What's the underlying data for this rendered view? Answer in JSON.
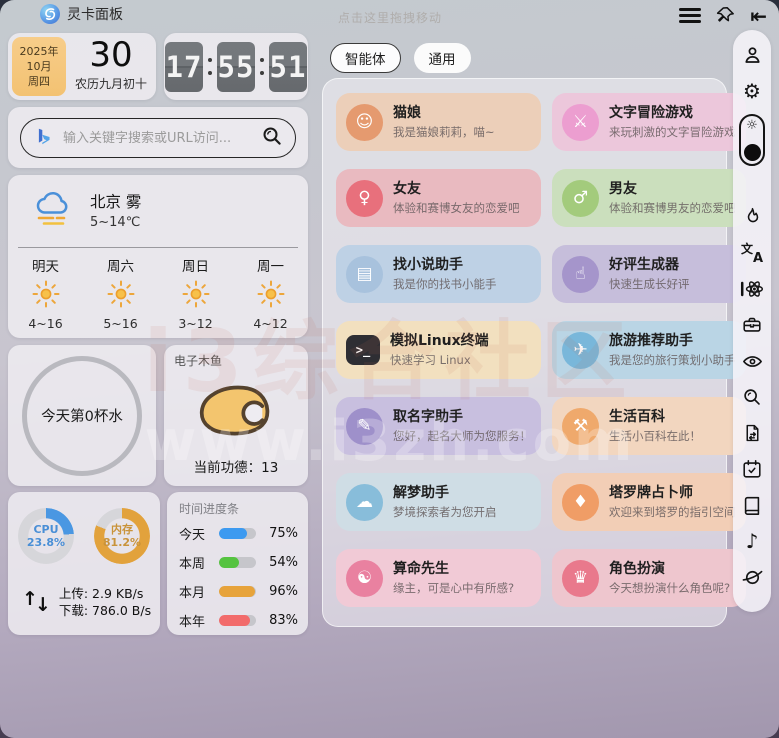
{
  "window": {
    "title": "灵卡面板",
    "drag_hint": "点击这里拖拽移动"
  },
  "titlebar": {
    "icons": [
      "menu-icon",
      "pin-icon",
      "collapse-icon"
    ],
    "collapse_glyph": "⇤"
  },
  "date_card": {
    "year": "2025年",
    "month": "10月",
    "weekday": "周四",
    "day": "30",
    "lunar": "农历九月初十"
  },
  "clock": {
    "hours": "17",
    "minutes": "55",
    "seconds": "51"
  },
  "search": {
    "placeholder": "输入关键字搜索或URL访问...",
    "engine_icon": "bing-logo-icon"
  },
  "weather": {
    "city_condition": "北京 雾",
    "temp_range": "5~14℃",
    "forecast": [
      {
        "day": "明天",
        "temps": "4~16"
      },
      {
        "day": "周六",
        "temps": "5~16"
      },
      {
        "day": "周日",
        "temps": "3~12"
      },
      {
        "day": "周一",
        "temps": "4~12"
      }
    ]
  },
  "water": {
    "label": "今天第0杯水"
  },
  "muyu": {
    "title": "电子木鱼",
    "merit": "当前功德：13"
  },
  "system": {
    "cpu_label": "CPU",
    "cpu_value": "23.8%",
    "cpu_pct": 23.8,
    "cpu_color": "#4a97e2",
    "mem_label": "内存",
    "mem_value": "81.2%",
    "mem_pct": 81.2,
    "mem_color": "#e2a23c",
    "upload": "上传: 2.9 KB/s",
    "download": "下载: 786.0 B/s"
  },
  "time_progress": {
    "title": "时间进度条",
    "rows": [
      {
        "label": "今天",
        "value": "75%",
        "pct": 75,
        "color": "#3d9af0"
      },
      {
        "label": "本周",
        "value": "54%",
        "pct": 54,
        "color": "#55c340"
      },
      {
        "label": "本月",
        "value": "96%",
        "pct": 96,
        "color": "#e7a33b"
      },
      {
        "label": "本年",
        "value": "83%",
        "pct": 83,
        "color": "#f26b6b"
      }
    ]
  },
  "tabs": [
    {
      "label": "智能体",
      "active": true
    },
    {
      "label": "通用",
      "active": false
    }
  ],
  "agents": {
    "cards": [
      {
        "title": "猫娘",
        "subtitle": "我是猫娘莉莉，喵~",
        "icon": "cat-girl-avatar",
        "glyph": "☺",
        "card_color": "#eccfb9",
        "avatar_color": "#e59a6f"
      },
      {
        "title": "文字冒险游戏",
        "subtitle": "来玩刺激的文字冒险游戏",
        "icon": "pixel-adventurer-avatar",
        "glyph": "⚔",
        "card_color": "#ecc7db",
        "avatar_color": "#ec9ed0"
      },
      {
        "title": "女友",
        "subtitle": "体验和赛博女友的恋爱吧",
        "icon": "girlfriend-avatar",
        "glyph": "♀",
        "card_color": "#e9bac0",
        "avatar_color": "#e8707c"
      },
      {
        "title": "男友",
        "subtitle": "体验和赛博男友的恋爱吧",
        "icon": "boyfriend-avatar",
        "glyph": "♂",
        "card_color": "#cbdfbd",
        "avatar_color": "#a3cb7c"
      },
      {
        "title": "找小说助手",
        "subtitle": "我是你的找书小能手",
        "icon": "book-search-avatar",
        "glyph": "▤",
        "card_color": "#bed1e5",
        "avatar_color": "#a8c2dd"
      },
      {
        "title": "好评生成器",
        "subtitle": "快速生成长好评",
        "icon": "thumbs-up-avatar",
        "glyph": "☝",
        "card_color": "#c6bedb",
        "avatar_color": "#a595cb"
      },
      {
        "title": "模拟Linux终端",
        "subtitle": "快速学习 Linux",
        "icon": "linux-terminal-avatar",
        "glyph": ">_",
        "card_color": "#f2e0bf",
        "avatar_color": "#2e2e33",
        "square": true
      },
      {
        "title": "旅游推荐助手",
        "subtitle": "我是您的旅行策划小助手",
        "icon": "travel-landscape-avatar",
        "glyph": "✈",
        "card_color": "#bad5e5",
        "avatar_color": "#79b7da"
      },
      {
        "title": "取名字助手",
        "subtitle": "您好，起名大师为您服务！",
        "icon": "baby-naming-avatar",
        "glyph": "✎",
        "card_color": "#c8bfdf",
        "avatar_color": "#9e90ca"
      },
      {
        "title": "生活百科",
        "subtitle": "生活小百科在此！",
        "icon": "life-tips-avatar",
        "glyph": "⚒",
        "card_color": "#f2d6bf",
        "avatar_color": "#efa96c"
      },
      {
        "title": "解梦助手",
        "subtitle": "梦境探索者为您开启",
        "icon": "dream-avatar",
        "glyph": "☁",
        "card_color": "#cfdde5",
        "avatar_color": "#88bdda"
      },
      {
        "title": "塔罗牌占卜师",
        "subtitle": "欢迎来到塔罗的指引空间",
        "icon": "tarot-avatar",
        "glyph": "♦",
        "card_color": "#f2ceb6",
        "avatar_color": "#f09d66"
      },
      {
        "title": "算命先生",
        "subtitle": "缘主，可是心中有所感?",
        "icon": "fortune-teller-avatar",
        "glyph": "☯",
        "card_color": "#f1cad6",
        "avatar_color": "#e981a0"
      },
      {
        "title": "角色扮演",
        "subtitle": "今天想扮演什么角色呢?",
        "icon": "roleplay-avatar",
        "glyph": "♛",
        "card_color": "#eec6ce",
        "avatar_color": "#e9798c"
      }
    ]
  },
  "sidebar": {
    "icons": [
      "user-icon",
      "settings-gear-icon",
      "theme-toggle",
      "flame-hot-icon",
      "translate-icon",
      "ai-agent-icon",
      "toolbox-icon",
      "eye-icon",
      "search-icon",
      "file-convert-icon",
      "calendar-check-icon",
      "notebook-icon",
      "music-note-icon",
      "planet-icon"
    ],
    "gear_glyph": "⚙",
    "sun_glyph": "☼",
    "music_glyph": "♪",
    "translate_zh": "文",
    "translate_en": "A"
  },
  "watermark": {
    "line1": "i3综合社区",
    "line2": "www.i3zh.com"
  }
}
